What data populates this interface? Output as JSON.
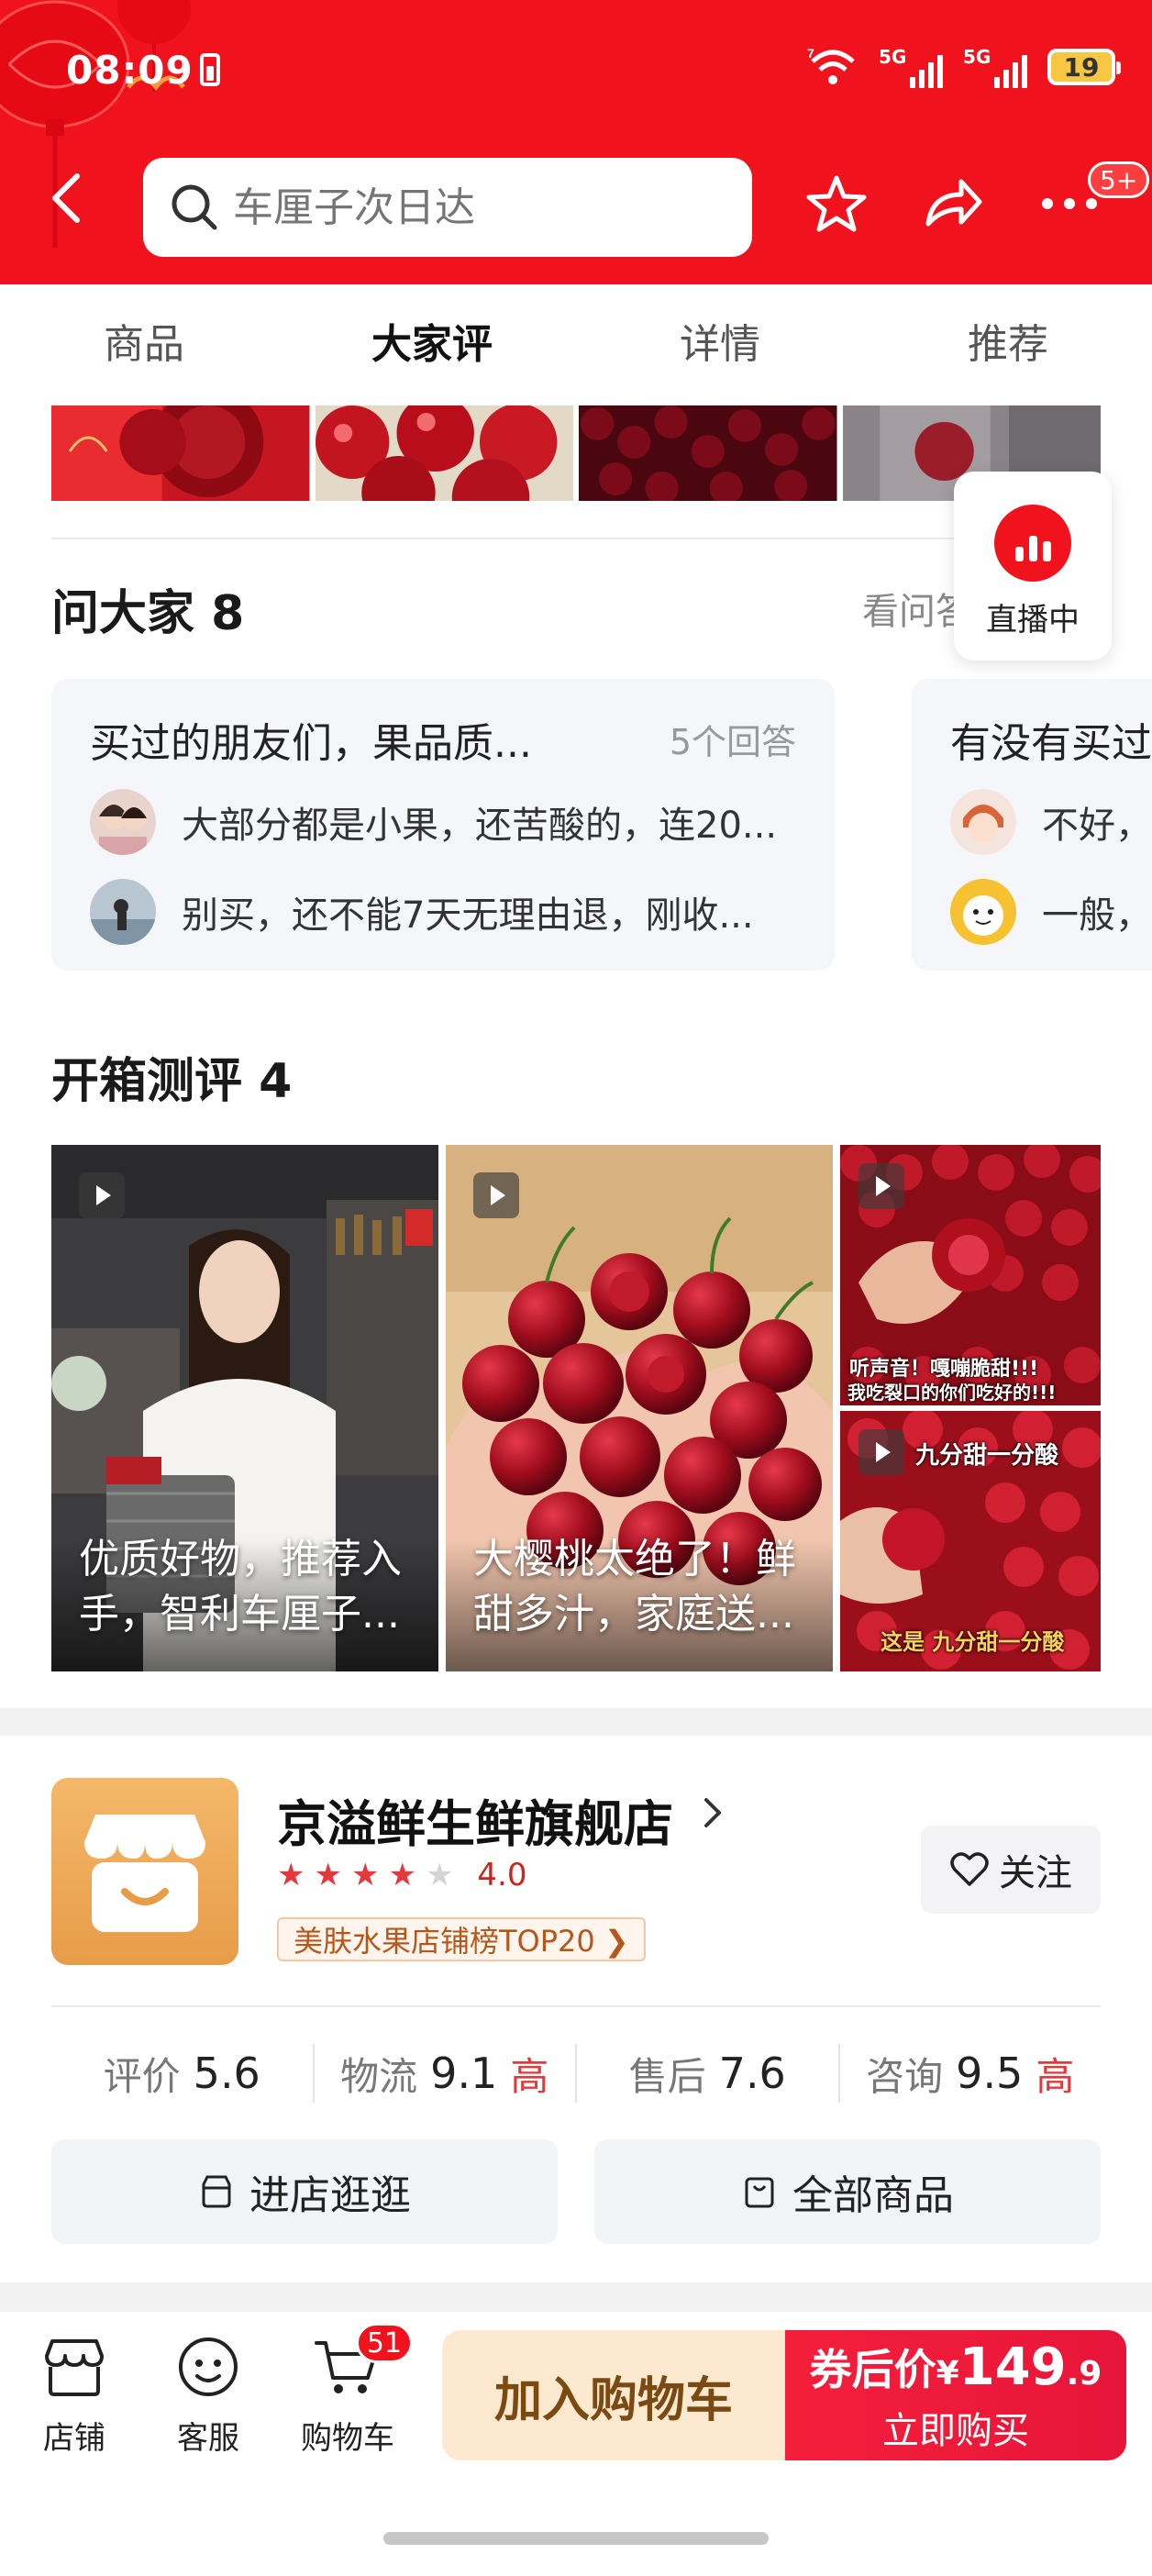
{
  "status_bar": {
    "time": "08:09",
    "battery": "19",
    "signal_labels": [
      "5G",
      "5G"
    ]
  },
  "header": {
    "search_placeholder": "车厘子次日达",
    "more_badge": "5+"
  },
  "tabs": [
    {
      "label": "商品",
      "active": false
    },
    {
      "label": "大家评",
      "active": true
    },
    {
      "label": "详情",
      "active": false
    },
    {
      "label": "推荐",
      "active": false
    }
  ],
  "live": {
    "label": "直播中"
  },
  "qa": {
    "title": "问大家 8",
    "more_link": "看问答",
    "cards": [
      {
        "question": "买过的朋友们，果品质...",
        "answer_count": "5个回答",
        "answers": [
          "大部分都是小果，还苦酸的，连20...",
          "别买，还不能7天无理由退，刚收..."
        ]
      },
      {
        "question": "有没有买过",
        "answer_count": "",
        "answers": [
          "不好，",
          "一般，"
        ]
      }
    ]
  },
  "unboxing": {
    "title": "开箱测评 4",
    "videos": [
      {
        "caption": "优质好物，推荐入手，智利车厘子..."
      },
      {
        "caption": "大樱桃太绝了！鲜甜多汁，家庭送..."
      },
      {
        "overlay_text": [
          "听声音！嘎嘣脆甜!!!",
          "我吃裂口的你们吃好的!!!"
        ]
      },
      {
        "overlay_text": [
          "九分甜一分酸",
          "这是 九分甜一分酸"
        ]
      }
    ]
  },
  "store": {
    "name": "京溢鲜生鲜旗舰店",
    "rating": "4.0",
    "stars_filled": 4,
    "stars_total": 5,
    "rank_badge": "美肤水果店铺榜TOP20 ❯",
    "follow_label": "关注",
    "scores": [
      {
        "label": "评价",
        "value": "5.6",
        "tag": ""
      },
      {
        "label": "物流",
        "value": "9.1",
        "tag": "高"
      },
      {
        "label": "售后",
        "value": "7.6",
        "tag": ""
      },
      {
        "label": "咨询",
        "value": "9.5",
        "tag": "高"
      }
    ],
    "buttons": {
      "visit": "进店逛逛",
      "all_products": "全部商品"
    }
  },
  "bottom_bar": {
    "shop_label": "店铺",
    "service_label": "客服",
    "cart_label": "购物车",
    "cart_badge": "51",
    "add_to_cart": "加入购物车",
    "price_prefix": "券后价",
    "currency": "¥",
    "price_int": "149",
    "price_dec": ".9",
    "buy_now": "立即购买"
  },
  "colors": {
    "brand_red": "#f0131d",
    "accent_gold": "#fce9cf",
    "high_tag": "#e4393c"
  }
}
